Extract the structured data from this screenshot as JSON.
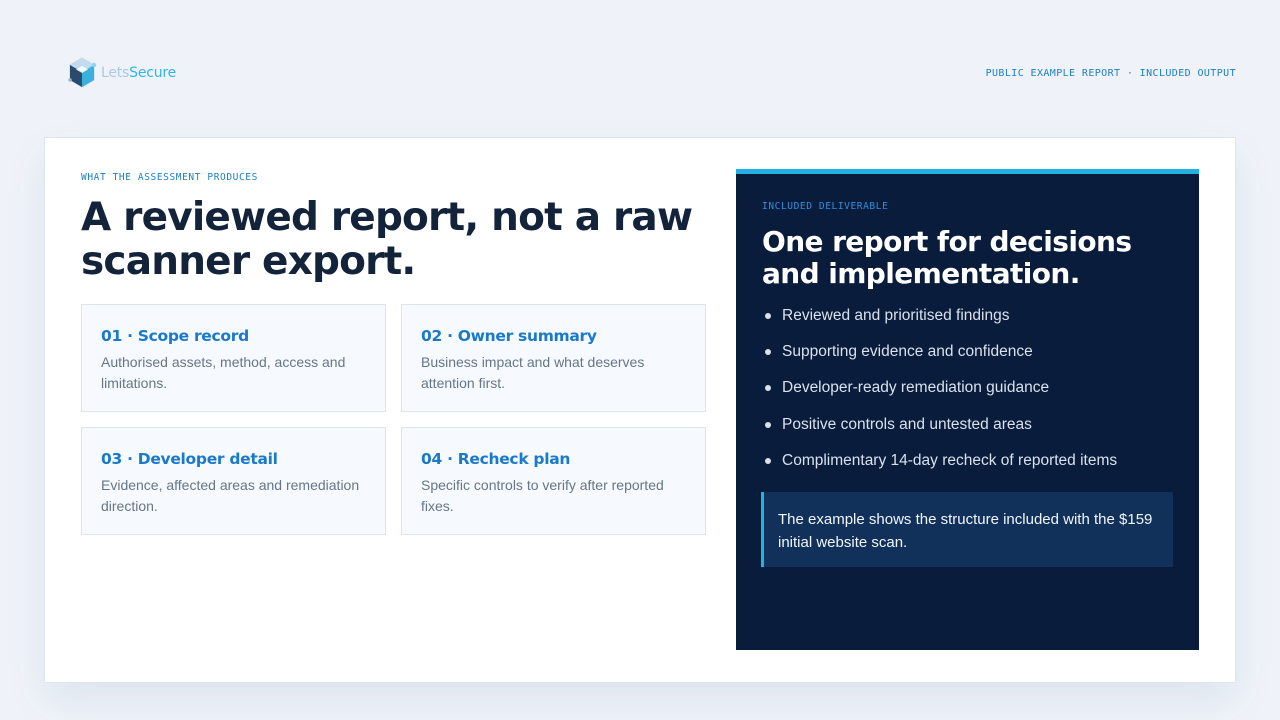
{
  "brand": {
    "name_part1": "Lets",
    "name_part2": "Secure",
    "logo_icon": "hexagon-cube-logo-icon",
    "colors": {
      "name_part1": "#a9c9e4",
      "name_part2": "#2fb5e6"
    }
  },
  "header": {
    "tag": "PUBLIC EXAMPLE REPORT · INCLUDED OUTPUT"
  },
  "main": {
    "eyebrow": "WHAT THE ASSESSMENT PRODUCES",
    "headline": "A reviewed report, not a raw scanner export.",
    "tiles": [
      {
        "title": "01 · Scope record",
        "body": "Authorised assets, method, access and limitations."
      },
      {
        "title": "02 · Owner summary",
        "body": "Business impact and what deserves attention first."
      },
      {
        "title": "03 · Developer detail",
        "body": "Evidence, affected areas and remediation direction."
      },
      {
        "title": "04 · Recheck plan",
        "body": "Specific controls to verify after reported fixes."
      }
    ]
  },
  "panel": {
    "eyebrow": "INCLUDED DELIVERABLE",
    "title": "One report for decisions and implementation.",
    "bullets": [
      "Reviewed and prioritised findings",
      "Supporting evidence and confidence",
      "Developer-ready remediation guidance",
      "Positive controls and untested areas",
      "Complimentary 14-day recheck of reported items"
    ],
    "note": "The example shows the structure included with the $159 initial website scan."
  },
  "colors": {
    "accent": "#1a79cb",
    "panel_bg": "#0a1c3b",
    "panel_accent": "#24b1e0",
    "headline": "#13233a",
    "page_bg": "#eff3f9"
  }
}
